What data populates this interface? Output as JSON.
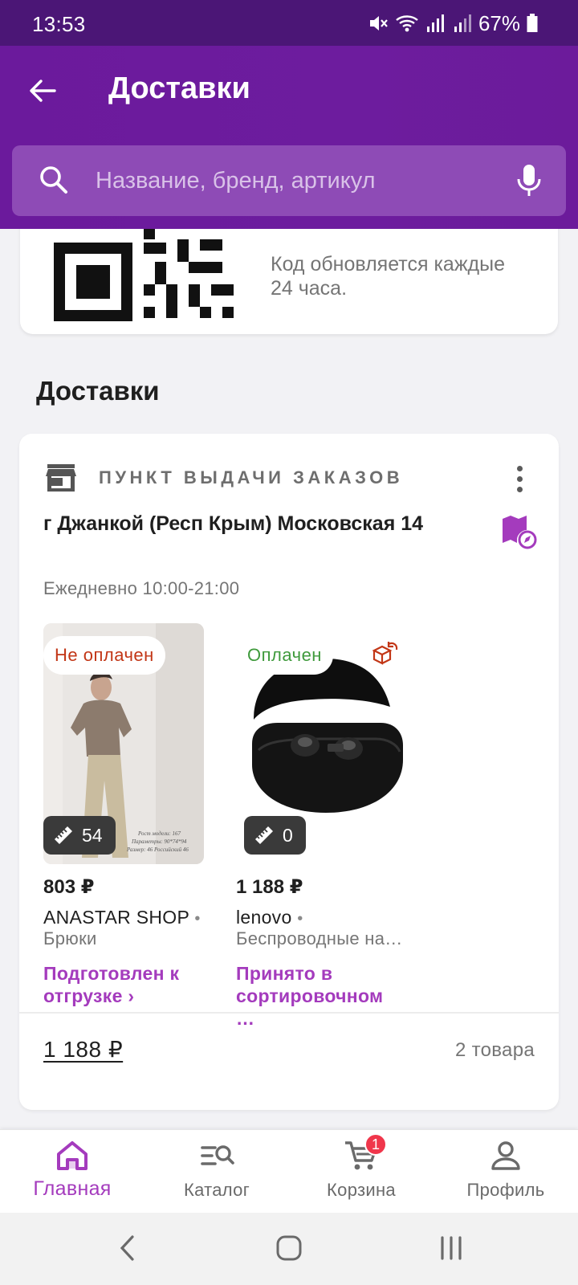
{
  "status_bar": {
    "time": "13:53",
    "battery": "67%"
  },
  "app_bar": {
    "title": "Доставки",
    "search_placeholder": "Название, бренд, артикул"
  },
  "qr_card": {
    "note": "Код обновляется каждые 24 часа."
  },
  "section_title": "Доставки",
  "delivery": {
    "type_label": "ПУНКТ ВЫДАЧИ ЗАКАЗОВ",
    "address": "г Джанкой (Респ Крым) Московская 14",
    "hours": "Ежедневно 10:00-21:00",
    "products": [
      {
        "payment": "Не оплачен",
        "size": "54",
        "price": "803 ₽",
        "brand": "ANASTAR SHOP",
        "name": "Брюки",
        "status_line1": "Подготовлен к",
        "status_line2": "отгрузке ›"
      },
      {
        "payment": "Оплачен",
        "size": "0",
        "price": "1 188 ₽",
        "brand": "lenovo",
        "name": "Беспроводные на…",
        "status_line1": "Принято в",
        "status_line2": "сортировочном …"
      }
    ],
    "total": "1 188 ₽",
    "items_count": "2 товара"
  },
  "bottom_nav": {
    "home": "Главная",
    "catalog": "Каталог",
    "cart": "Корзина",
    "cart_badge": "1",
    "profile": "Профиль"
  },
  "colors": {
    "brand_purple": "#6b1a9c",
    "accent_purple": "#a43bbd",
    "unpaid_red": "#c23616",
    "paid_green": "#3f9a3c"
  }
}
